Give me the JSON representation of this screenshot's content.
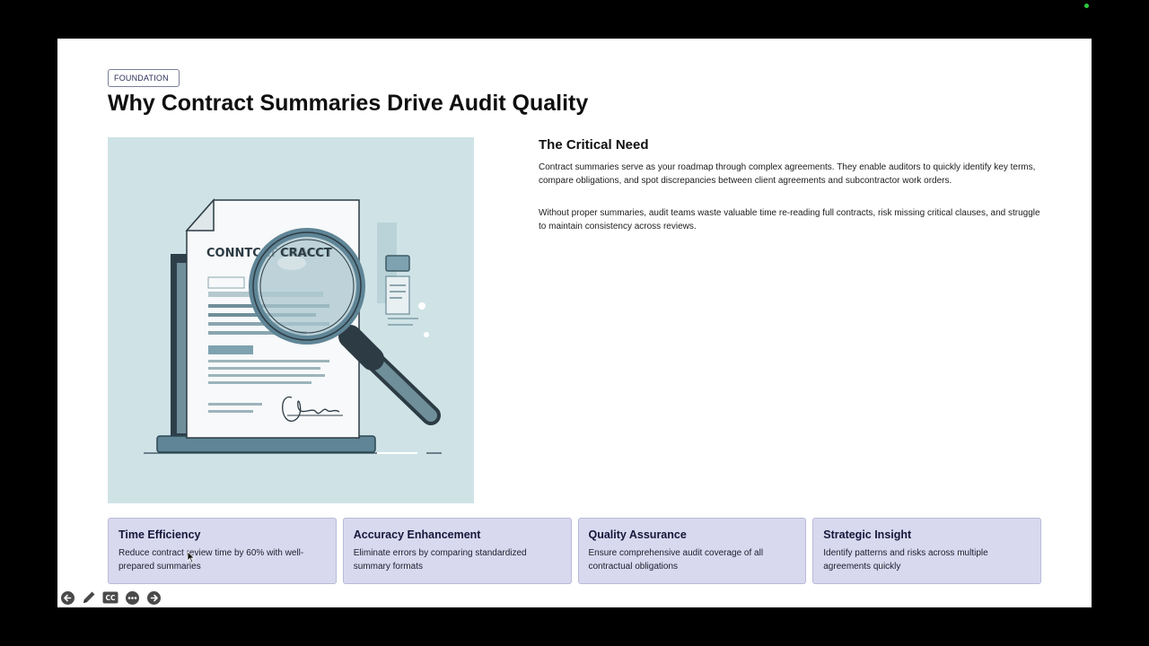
{
  "slide": {
    "tag": "FOUNDATION",
    "title": "Why Contract Summaries Drive Audit Quality",
    "illustration": {
      "doc_heading": "CONNTCAT  CRACCT",
      "icon": "contract-magnifier-illustration"
    },
    "critical_need": {
      "heading": "The Critical Need",
      "paragraphs": [
        "Contract summaries serve as your roadmap through complex agreements. They enable auditors to quickly identify key terms, compare obligations, and spot discrepancies between client agreements and subcontractor work orders.",
        "Without proper summaries, audit teams waste valuable time re-reading full contracts, risk missing critical clauses, and struggle to maintain consistency across reviews."
      ]
    },
    "cards": [
      {
        "title": "Time Efficiency",
        "desc": "Reduce contract review time by 60% with well-prepared summaries"
      },
      {
        "title": "Accuracy Enhancement",
        "desc": "Eliminate errors by comparing standardized summary formats"
      },
      {
        "title": "Quality Assurance",
        "desc": "Ensure comprehensive audit coverage of all contractual obligations"
      },
      {
        "title": "Strategic Insight",
        "desc": "Identify patterns and risks across multiple agreements quickly"
      }
    ]
  },
  "controls": {
    "prev_icon": "arrow-left-icon",
    "pen_icon": "pencil-icon",
    "cc_label": "CC",
    "more_icon": "ellipsis-icon",
    "next_icon": "arrow-right-icon"
  },
  "colors": {
    "background": "#000000",
    "slide": "#ffffff",
    "card_bg": "#d8d9ee",
    "illustration_bg": "#cfe3e7",
    "status_dot": "#2ecc40"
  }
}
